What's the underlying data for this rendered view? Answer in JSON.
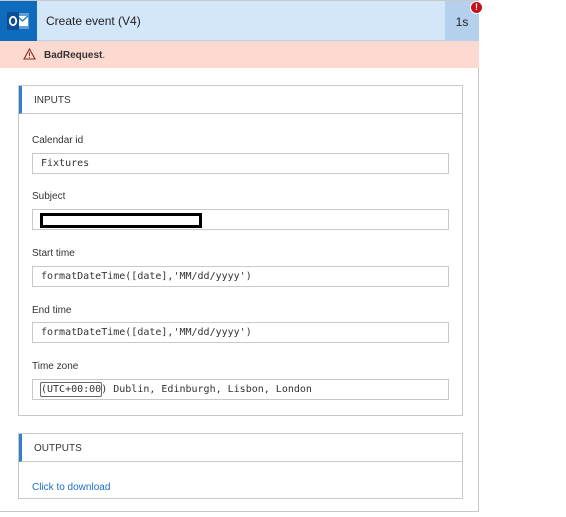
{
  "header": {
    "title": "Create event (V4)",
    "duration": "1s",
    "error_badge": "!",
    "app_icon": "outlook-icon",
    "colors": {
      "header_bg": "#d4e6f9",
      "icon_bg": "#0f6cbd",
      "duration_bg": "#b4d0ed",
      "error": "#c50f1f"
    }
  },
  "alert": {
    "icon": "warning-icon",
    "text": "BadRequest",
    "suffix": ".",
    "background": "#fdd9cf"
  },
  "inputs": {
    "heading": "INPUTS",
    "fields": [
      {
        "label": "Calendar id",
        "value": "Fixtures"
      },
      {
        "label": "Subject",
        "value": ""
      },
      {
        "label": "Start time",
        "value": "formatDateTime([date],'MM/dd/yyyy')"
      },
      {
        "label": "End time",
        "value": "formatDateTime([date],'MM/dd/yyyy')"
      },
      {
        "label": "Time zone",
        "value": "(UTC+00:00) Dublin, Edinburgh, Lisbon, London"
      }
    ]
  },
  "outputs": {
    "heading": "OUTPUTS",
    "link": "Click to download",
    "link_color": "#1a6fc9"
  }
}
